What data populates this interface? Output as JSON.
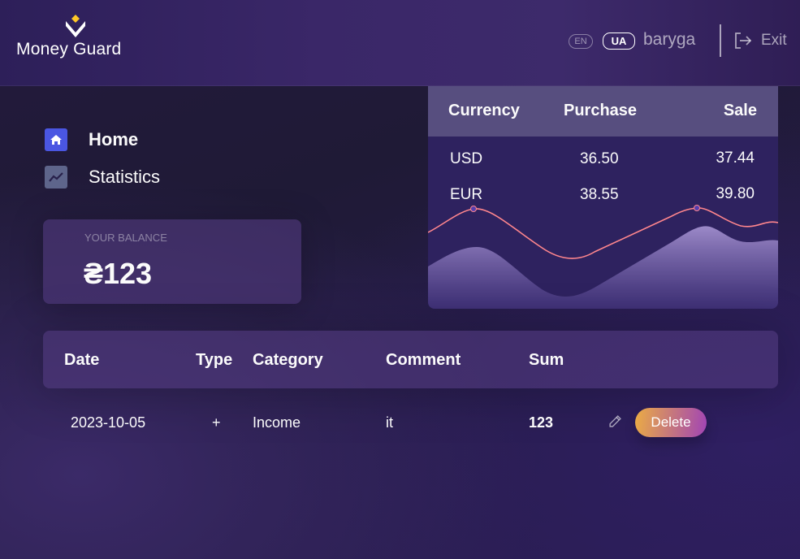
{
  "header": {
    "logo_text": "Money Guard",
    "lang_en": "EN",
    "lang_ua": "UA",
    "username": "baryga",
    "exit_label": "Exit"
  },
  "nav": {
    "home": "Home",
    "statistics": "Statistics"
  },
  "balance": {
    "label": "YOUR BALANCE",
    "value": "₴123"
  },
  "currency": {
    "headers": [
      "Currency",
      "Purchase",
      "Sale"
    ],
    "rows": [
      {
        "currency": "USD",
        "purchase": "36.50",
        "sale": "37.44"
      },
      {
        "currency": "EUR",
        "purchase": "38.55",
        "sale": "39.80"
      }
    ]
  },
  "transactions": {
    "headers": [
      "Date",
      "Type",
      "Category",
      "Comment",
      "Sum"
    ],
    "rows": [
      {
        "date": "2023-10-05",
        "type": "+",
        "category": "Income",
        "comment": "it",
        "sum": "123",
        "delete_label": "Delete"
      }
    ]
  },
  "colors": {
    "accent_home": "#4a56e2",
    "delete_gradient_start": "#ebac44",
    "delete_gradient_end": "#a144b5",
    "chart_line": "#ff868d"
  }
}
